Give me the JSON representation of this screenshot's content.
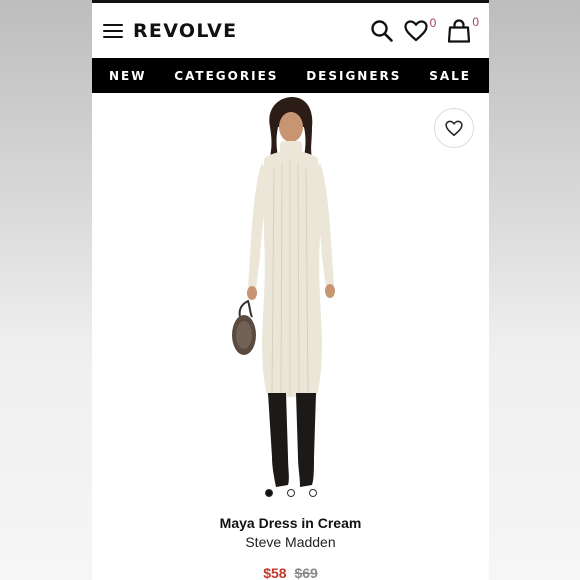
{
  "header": {
    "logo": "REVOLVE",
    "wishlist_count": "0",
    "cart_count": "0"
  },
  "nav": {
    "items": [
      {
        "label": "NEW"
      },
      {
        "label": "CATEGORIES"
      },
      {
        "label": "DESIGNERS"
      },
      {
        "label": "SALE"
      }
    ]
  },
  "product": {
    "name": "Maya Dress in Cream",
    "brand": "Steve Madden",
    "sale_price": "$58",
    "original_price": "$69",
    "image_count": 3,
    "active_image": 1
  },
  "icons": {
    "menu": "menu-icon",
    "search": "search-icon",
    "wishlist": "heart-icon",
    "cart": "bag-icon",
    "favorite": "heart-outline-icon"
  },
  "colors": {
    "nav_background": "#000000",
    "badge_count": "#a33a6e",
    "sale_price": "#c0392b",
    "original_price": "#888888"
  }
}
